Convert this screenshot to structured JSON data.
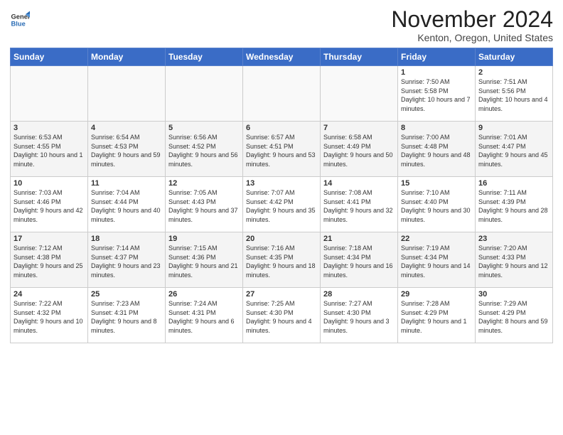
{
  "logo": {
    "line1": "General",
    "line2": "Blue"
  },
  "title": "November 2024",
  "location": "Kenton, Oregon, United States",
  "days_header": [
    "Sunday",
    "Monday",
    "Tuesday",
    "Wednesday",
    "Thursday",
    "Friday",
    "Saturday"
  ],
  "weeks": [
    [
      {
        "day": "",
        "info": ""
      },
      {
        "day": "",
        "info": ""
      },
      {
        "day": "",
        "info": ""
      },
      {
        "day": "",
        "info": ""
      },
      {
        "day": "",
        "info": ""
      },
      {
        "day": "1",
        "info": "Sunrise: 7:50 AM\nSunset: 5:58 PM\nDaylight: 10 hours\nand 7 minutes."
      },
      {
        "day": "2",
        "info": "Sunrise: 7:51 AM\nSunset: 5:56 PM\nDaylight: 10 hours\nand 4 minutes."
      }
    ],
    [
      {
        "day": "3",
        "info": "Sunrise: 6:53 AM\nSunset: 4:55 PM\nDaylight: 10 hours\nand 1 minute."
      },
      {
        "day": "4",
        "info": "Sunrise: 6:54 AM\nSunset: 4:53 PM\nDaylight: 9 hours\nand 59 minutes."
      },
      {
        "day": "5",
        "info": "Sunrise: 6:56 AM\nSunset: 4:52 PM\nDaylight: 9 hours\nand 56 minutes."
      },
      {
        "day": "6",
        "info": "Sunrise: 6:57 AM\nSunset: 4:51 PM\nDaylight: 9 hours\nand 53 minutes."
      },
      {
        "day": "7",
        "info": "Sunrise: 6:58 AM\nSunset: 4:49 PM\nDaylight: 9 hours\nand 50 minutes."
      },
      {
        "day": "8",
        "info": "Sunrise: 7:00 AM\nSunset: 4:48 PM\nDaylight: 9 hours\nand 48 minutes."
      },
      {
        "day": "9",
        "info": "Sunrise: 7:01 AM\nSunset: 4:47 PM\nDaylight: 9 hours\nand 45 minutes."
      }
    ],
    [
      {
        "day": "10",
        "info": "Sunrise: 7:03 AM\nSunset: 4:46 PM\nDaylight: 9 hours\nand 42 minutes."
      },
      {
        "day": "11",
        "info": "Sunrise: 7:04 AM\nSunset: 4:44 PM\nDaylight: 9 hours\nand 40 minutes."
      },
      {
        "day": "12",
        "info": "Sunrise: 7:05 AM\nSunset: 4:43 PM\nDaylight: 9 hours\nand 37 minutes."
      },
      {
        "day": "13",
        "info": "Sunrise: 7:07 AM\nSunset: 4:42 PM\nDaylight: 9 hours\nand 35 minutes."
      },
      {
        "day": "14",
        "info": "Sunrise: 7:08 AM\nSunset: 4:41 PM\nDaylight: 9 hours\nand 32 minutes."
      },
      {
        "day": "15",
        "info": "Sunrise: 7:10 AM\nSunset: 4:40 PM\nDaylight: 9 hours\nand 30 minutes."
      },
      {
        "day": "16",
        "info": "Sunrise: 7:11 AM\nSunset: 4:39 PM\nDaylight: 9 hours\nand 28 minutes."
      }
    ],
    [
      {
        "day": "17",
        "info": "Sunrise: 7:12 AM\nSunset: 4:38 PM\nDaylight: 9 hours\nand 25 minutes."
      },
      {
        "day": "18",
        "info": "Sunrise: 7:14 AM\nSunset: 4:37 PM\nDaylight: 9 hours\nand 23 minutes."
      },
      {
        "day": "19",
        "info": "Sunrise: 7:15 AM\nSunset: 4:36 PM\nDaylight: 9 hours\nand 21 minutes."
      },
      {
        "day": "20",
        "info": "Sunrise: 7:16 AM\nSunset: 4:35 PM\nDaylight: 9 hours\nand 18 minutes."
      },
      {
        "day": "21",
        "info": "Sunrise: 7:18 AM\nSunset: 4:34 PM\nDaylight: 9 hours\nand 16 minutes."
      },
      {
        "day": "22",
        "info": "Sunrise: 7:19 AM\nSunset: 4:34 PM\nDaylight: 9 hours\nand 14 minutes."
      },
      {
        "day": "23",
        "info": "Sunrise: 7:20 AM\nSunset: 4:33 PM\nDaylight: 9 hours\nand 12 minutes."
      }
    ],
    [
      {
        "day": "24",
        "info": "Sunrise: 7:22 AM\nSunset: 4:32 PM\nDaylight: 9 hours\nand 10 minutes."
      },
      {
        "day": "25",
        "info": "Sunrise: 7:23 AM\nSunset: 4:31 PM\nDaylight: 9 hours\nand 8 minutes."
      },
      {
        "day": "26",
        "info": "Sunrise: 7:24 AM\nSunset: 4:31 PM\nDaylight: 9 hours\nand 6 minutes."
      },
      {
        "day": "27",
        "info": "Sunrise: 7:25 AM\nSunset: 4:30 PM\nDaylight: 9 hours\nand 4 minutes."
      },
      {
        "day": "28",
        "info": "Sunrise: 7:27 AM\nSunset: 4:30 PM\nDaylight: 9 hours\nand 3 minutes."
      },
      {
        "day": "29",
        "info": "Sunrise: 7:28 AM\nSunset: 4:29 PM\nDaylight: 9 hours\nand 1 minute."
      },
      {
        "day": "30",
        "info": "Sunrise: 7:29 AM\nSunset: 4:29 PM\nDaylight: 8 hours\nand 59 minutes."
      }
    ]
  ]
}
